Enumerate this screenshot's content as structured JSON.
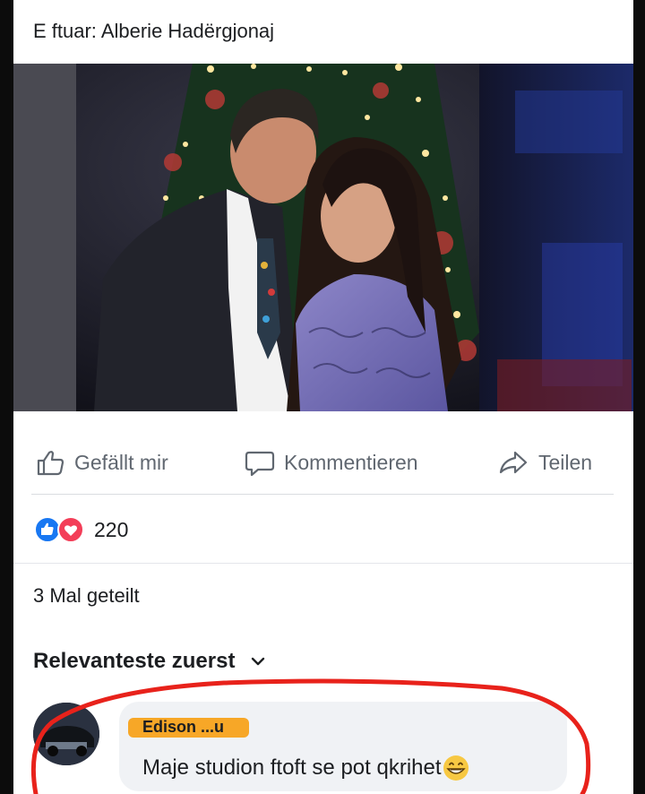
{
  "post": {
    "header": "E ftuar: Alberie Hadërgjonaj"
  },
  "actions": {
    "like_label": "Gefällt mir",
    "comment_label": "Kommentieren",
    "share_label": "Teilen"
  },
  "stats": {
    "reaction_count": "220",
    "shares_text": "3 Mal geteilt"
  },
  "comments_section": {
    "sort_label": "Relevanteste zuerst",
    "comment": {
      "author": "Edison ...u",
      "text": "Maje studion ftoft se pot qkrihet"
    }
  },
  "colors": {
    "annotation_red": "#e8221b",
    "highlight_orange": "#f7a21b",
    "like_blue": "#1877f2",
    "love_red": "#f33e58"
  }
}
